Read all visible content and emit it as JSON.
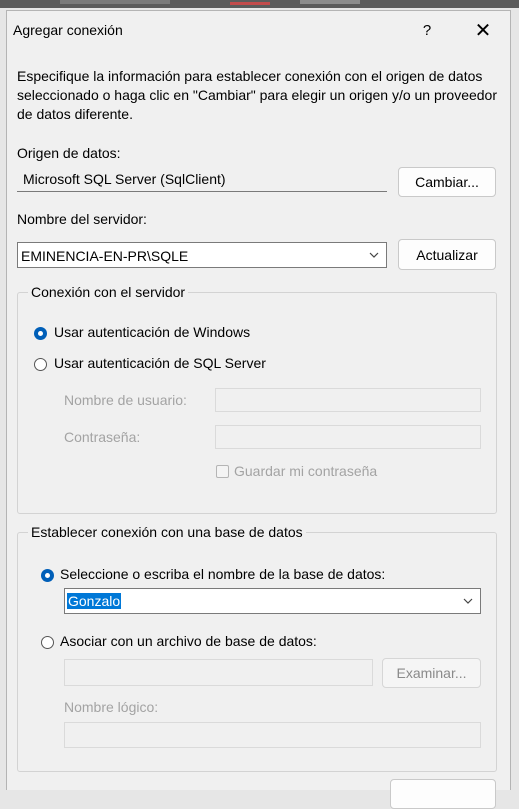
{
  "window": {
    "title": "Agregar conexión",
    "help_glyph": "?",
    "close_glyph": "✕"
  },
  "description": "Especifique la información para establecer conexión con el origen de datos seleccionado o haga clic en \"Cambiar\" para elegir un origen y/o un proveedor de datos diferente.",
  "data_source": {
    "label": "Origen de datos:",
    "value": "Microsoft SQL Server (SqlClient)",
    "change_button": "Cambiar..."
  },
  "server": {
    "label": "Nombre del servidor:",
    "value": "EMINENCIA-EN-PR\\SQLE",
    "refresh_button": "Actualizar"
  },
  "server_connection": {
    "legend": "Conexión con el servidor",
    "windows_auth": "Usar autenticación de Windows",
    "sql_auth": "Usar autenticación de SQL Server",
    "selected": "windows",
    "username_label": "Nombre de usuario:",
    "password_label": "Contraseña:",
    "save_password": "Guardar mi contraseña"
  },
  "database_connection": {
    "legend": "Establecer conexión con una base de datos",
    "select_option": "Seleccione o escriba el nombre de la base de datos:",
    "database_value": "Gonzalo",
    "attach_option": "Asociar con un archivo de base de datos:",
    "browse_button": "Examinar...",
    "logical_name_label": "Nombre lógico:",
    "selected": "select"
  },
  "colors": {
    "accent": "#005fb8",
    "selection": "#0078d7",
    "dialog_bg": "#f0f0f0"
  }
}
